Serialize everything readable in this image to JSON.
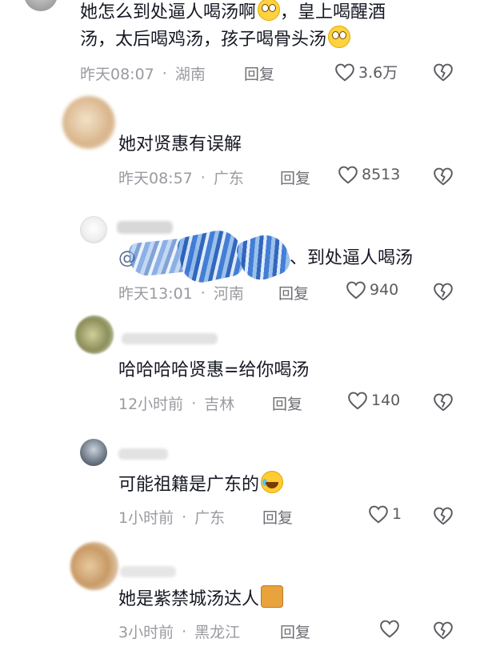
{
  "comments": [
    {
      "text_line1": "她怎么到处逼人喝汤啊",
      "text_line1b": "，皇上喝醒酒",
      "text_line2": "汤，太后喝鸡汤，孩子喝骨头汤",
      "time": "昨天08:07",
      "location": "湖南",
      "reply": "回复",
      "likes": "3.6万"
    },
    {
      "text": "她对贤惠有误解",
      "time": "昨天08:57",
      "location": "广东",
      "reply": "回复",
      "likes": "8513"
    },
    {
      "mention_prefix": "@",
      "text": "、到处逼人喝汤",
      "time": "昨天13:01",
      "location": "河南",
      "reply": "回复",
      "likes": "940"
    },
    {
      "text": "哈哈哈哈贤惠=给你喝汤",
      "time": "12小时前",
      "location": "吉林",
      "reply": "回复",
      "likes": "140"
    },
    {
      "text": "可能祖籍是广东的",
      "time": "1小时前",
      "location": "广东",
      "reply": "回复",
      "likes": "1"
    },
    {
      "text": "她是紫禁城汤达人",
      "time": "3小时前",
      "location": "黑龙江",
      "reply": "回复",
      "likes": ""
    }
  ],
  "icons": {
    "like": "heart-outline-icon",
    "dislike": "broken-heart-icon",
    "emoji_surprised": "surprised-face-emoji",
    "emoji_laugh": "laughing-tears-emoji",
    "emoji_sticker": "cat-sticker-emoji"
  },
  "colors": {
    "text": "#161823",
    "meta": "#9a9aa0",
    "icon": "#5a5a60"
  }
}
